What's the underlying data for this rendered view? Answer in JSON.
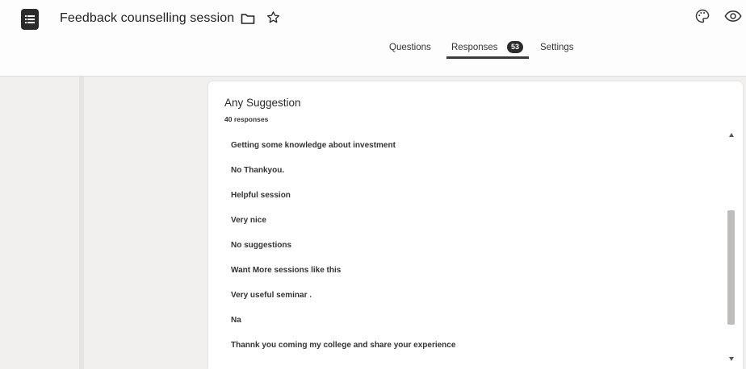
{
  "header": {
    "title": "Feedback counselling session",
    "icons": [
      "forms-icon",
      "folder-icon",
      "star-icon",
      "palette-icon",
      "eye-icon"
    ]
  },
  "tabs": [
    {
      "label": "Questions"
    },
    {
      "label": "Responses",
      "badge": "53",
      "active": true
    },
    {
      "label": "Settings"
    }
  ],
  "card": {
    "title": "Any Suggestion",
    "count": "40 responses",
    "responses": [
      "Getting some knowledge about investment",
      "No Thankyou.",
      "Helpful session",
      "Very nice",
      "No suggestions",
      "Want More sessions like this",
      "Very useful seminar .",
      "Na",
      "Thannk you coming my college and share your experience"
    ]
  },
  "colors": {
    "accent": "#2b2b2b",
    "background": "#f2f0ee",
    "card": "#ffffff"
  }
}
